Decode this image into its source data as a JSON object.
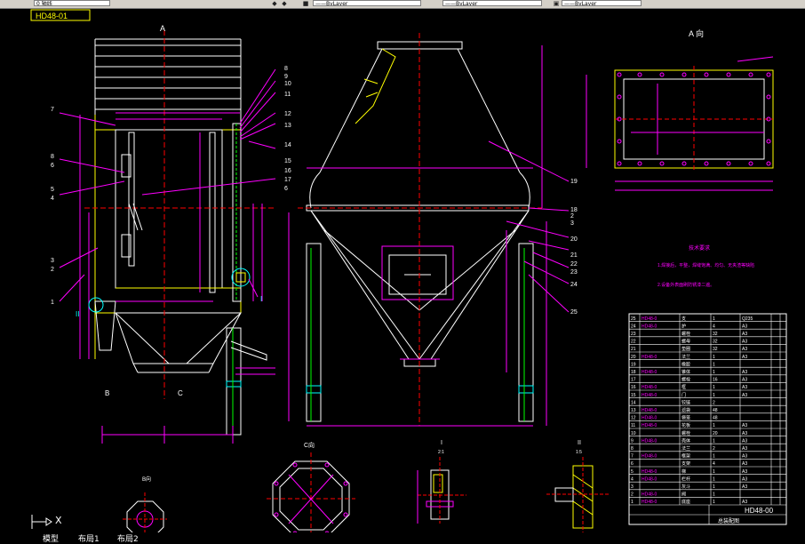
{
  "toolbar": {
    "layer_text": "0 轴线",
    "combo1": "——ByLayer",
    "combo2": "——ByLayer",
    "combo3": "——ByLayer"
  },
  "title_tag": "HD48-01",
  "view_labels": {
    "view_a_top": "A",
    "view_a_right": "A 向",
    "b_left": "B",
    "c_left": "C",
    "c_section": "C向",
    "b_section": "B向",
    "detail_i": "I",
    "detail_ii": "II",
    "detail_i_scale": "2:1",
    "detail_ii_scale": "1:5",
    "marker_i": "I",
    "marker_ii": "II"
  },
  "tech_req": {
    "title": "技术要求",
    "line1": "1.焊接后，平整，焊缝饱满、均匀、无夹渣等缺陷",
    "line2": "2.设备外表面刷防锈漆二遍。"
  },
  "balloons_left": [
    "7",
    "8",
    "6",
    "5",
    "4",
    "3",
    "2",
    "1"
  ],
  "balloons_mid": [
    "8",
    "9",
    "10",
    "11",
    "12",
    "13",
    "14",
    "15",
    "16",
    "17",
    "6"
  ],
  "balloons_right": [
    "19",
    "18",
    "2",
    "3",
    "20",
    "21",
    "22",
    "23",
    "24",
    "25"
  ],
  "bom_rows": [
    [
      "25",
      "HD48-0",
      "支",
      "1",
      "Q235",
      "",
      ""
    ],
    [
      "24",
      "HD48-0",
      "护",
      "4",
      "A3",
      "",
      ""
    ],
    [
      "23",
      "",
      "螺栓",
      "32",
      "A3",
      "",
      ""
    ],
    [
      "22",
      "",
      "螺母",
      "32",
      "A3",
      "",
      ""
    ],
    [
      "21",
      "",
      "垫圈",
      "32",
      "A3",
      "",
      ""
    ],
    [
      "20",
      "HD48-0",
      "法兰",
      "1",
      "A3",
      "",
      ""
    ],
    [
      "19",
      "",
      "橡胶",
      "1",
      "",
      "",
      ""
    ],
    [
      "18",
      "HD48-0",
      "锥体",
      "1",
      "A3",
      "",
      ""
    ],
    [
      "17",
      "",
      "螺栓",
      "16",
      "A3",
      "",
      ""
    ],
    [
      "16",
      "HD48-0",
      "框",
      "1",
      "A3",
      "",
      ""
    ],
    [
      "15",
      "HD48-0",
      "门",
      "1",
      "A3",
      "",
      ""
    ],
    [
      "14",
      "",
      "铰链",
      "2",
      "",
      "",
      ""
    ],
    [
      "13",
      "HD48-0",
      "滤袋",
      "48",
      "",
      "",
      ""
    ],
    [
      "12",
      "HD48-0",
      "袋笼",
      "48",
      "",
      "",
      ""
    ],
    [
      "11",
      "HD48-0",
      "花板",
      "1",
      "A3",
      "",
      ""
    ],
    [
      "10",
      "",
      "螺栓",
      "20",
      "A3",
      "",
      ""
    ],
    [
      "9",
      "HD48-0",
      "壳体",
      "1",
      "A3",
      "",
      ""
    ],
    [
      "8",
      "",
      "法兰",
      "2",
      "A3",
      "",
      ""
    ],
    [
      "7",
      "HD48-0",
      "框架",
      "1",
      "A3",
      "",
      ""
    ],
    [
      "6",
      "",
      "支架",
      "4",
      "A3",
      "",
      ""
    ],
    [
      "5",
      "HD48-0",
      "梯",
      "1",
      "A3",
      "",
      ""
    ],
    [
      "4",
      "HD48-0",
      "栏杆",
      "1",
      "A3",
      "",
      ""
    ],
    [
      "3",
      "",
      "灰斗",
      "1",
      "A3",
      "",
      ""
    ],
    [
      "2",
      "HD48-0",
      "阀",
      "1",
      "",
      "",
      ""
    ],
    [
      "1",
      "HD48-0",
      "底座",
      "1",
      "A3",
      "",
      ""
    ]
  ],
  "title_block": {
    "drawing_no": "HD48-00",
    "name": "总装配图"
  },
  "tabs": [
    "模型",
    "布局1",
    "布局2"
  ],
  "ucs_label": "X"
}
